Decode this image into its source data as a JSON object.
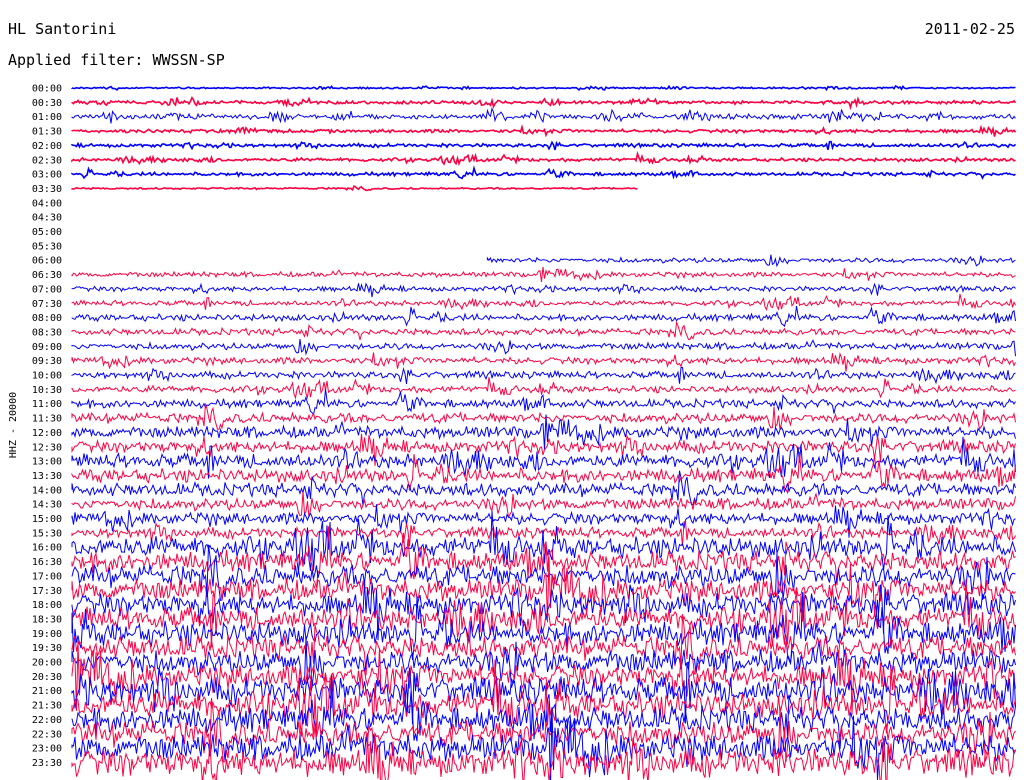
{
  "header": {
    "station": "HL Santorini",
    "date": "2011-02-25",
    "filter": "Applied filter: WWSSN-SP"
  },
  "colors": {
    "even": "#0000ff",
    "odd": "#ff0040"
  },
  "chart_data": {
    "type": "line",
    "title": "",
    "ylabel": "HHZ - 20000",
    "times": [
      "00:00",
      "00:30",
      "01:00",
      "01:30",
      "02:00",
      "02:30",
      "03:00",
      "03:30",
      "04:00",
      "04:30",
      "05:00",
      "05:30",
      "06:00",
      "06:30",
      "07:00",
      "07:30",
      "08:00",
      "08:30",
      "09:00",
      "09:30",
      "10:00",
      "10:30",
      "11:00",
      "11:30",
      "12:00",
      "12:30",
      "13:00",
      "13:30",
      "14:00",
      "14:30",
      "15:00",
      "15:30",
      "16:00",
      "16:30",
      "17:00",
      "17:30",
      "18:00",
      "18:30",
      "19:00",
      "19:30",
      "20:00",
      "20:30",
      "21:00",
      "21:30",
      "22:00",
      "22:30",
      "23:00",
      "23:30"
    ],
    "amplitude": [
      1,
      2,
      3,
      2,
      2,
      2,
      2,
      1,
      0,
      0,
      0,
      0,
      3,
      3,
      3,
      3,
      4,
      4,
      4,
      4,
      4,
      4,
      5,
      6,
      7,
      7,
      8,
      8,
      8,
      7,
      7,
      6,
      12,
      12,
      13,
      13,
      13,
      13,
      14,
      14,
      14,
      14,
      15,
      15,
      15,
      15,
      16,
      16
    ],
    "coverage": [
      [
        0,
        1
      ],
      [
        0,
        1
      ],
      [
        0,
        1
      ],
      [
        0,
        1
      ],
      [
        0,
        1
      ],
      [
        0,
        1
      ],
      [
        0,
        1
      ],
      [
        0,
        0.6
      ],
      [
        0,
        0
      ],
      [
        0,
        0
      ],
      [
        0,
        0
      ],
      [
        0,
        0
      ],
      [
        0.44,
        1
      ],
      [
        0,
        1
      ],
      [
        0,
        1
      ],
      [
        0,
        1
      ],
      [
        0,
        1
      ],
      [
        0,
        1
      ],
      [
        0,
        1
      ],
      [
        0,
        1
      ],
      [
        0,
        1
      ],
      [
        0,
        1
      ],
      [
        0,
        1
      ],
      [
        0,
        1
      ],
      [
        0,
        1
      ],
      [
        0,
        1
      ],
      [
        0,
        1
      ],
      [
        0,
        1
      ],
      [
        0,
        1
      ],
      [
        0,
        1
      ],
      [
        0,
        1
      ],
      [
        0,
        1
      ],
      [
        0,
        1
      ],
      [
        0,
        1
      ],
      [
        0,
        1
      ],
      [
        0,
        1
      ],
      [
        0,
        1
      ],
      [
        0,
        1
      ],
      [
        0,
        1
      ],
      [
        0,
        1
      ],
      [
        0,
        1
      ],
      [
        0,
        1
      ],
      [
        0,
        1
      ],
      [
        0,
        1
      ],
      [
        0,
        1
      ],
      [
        0,
        1
      ],
      [
        0,
        1
      ],
      [
        0,
        1
      ]
    ]
  }
}
